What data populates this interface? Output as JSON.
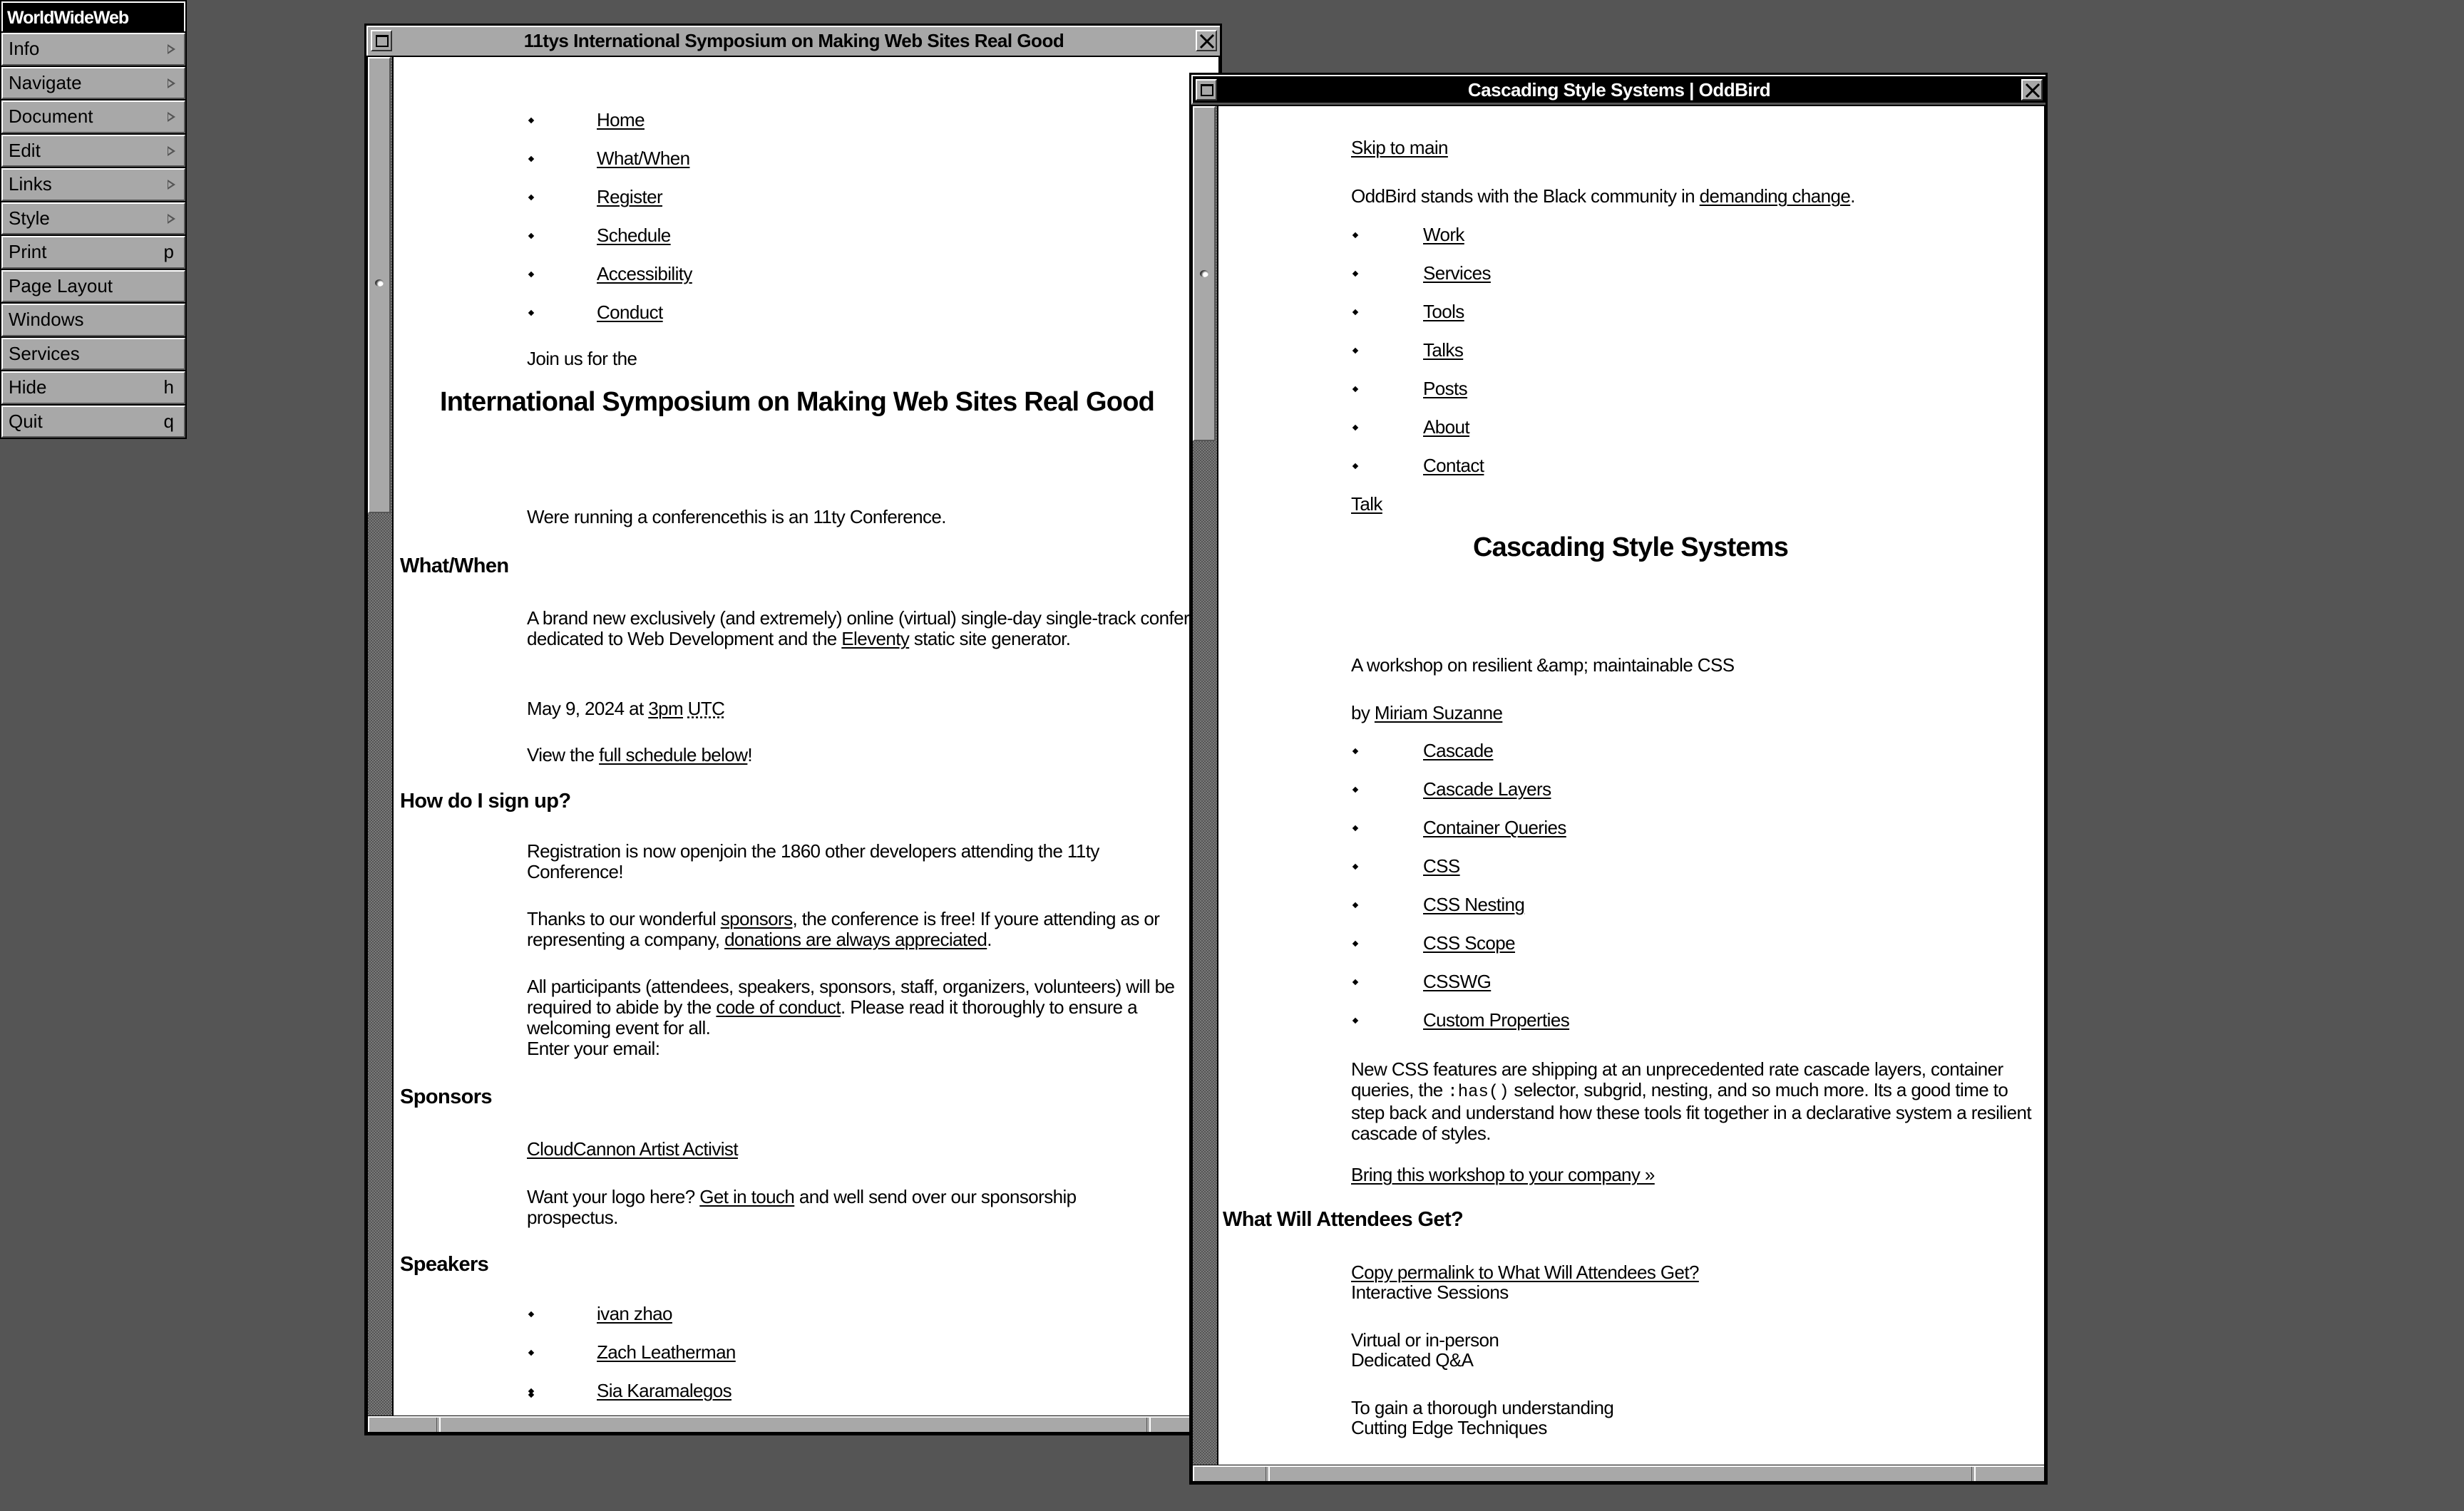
{
  "menu": {
    "title": "WorldWideWeb",
    "items": [
      {
        "label": "Info",
        "submenu": true
      },
      {
        "label": "Navigate",
        "submenu": true
      },
      {
        "label": "Document",
        "submenu": true
      },
      {
        "label": "Edit",
        "submenu": true
      },
      {
        "label": "Links",
        "submenu": true
      },
      {
        "label": "Style",
        "submenu": true
      },
      {
        "label": "Print",
        "key": "p"
      },
      {
        "label": "Page Layout"
      },
      {
        "label": "Windows"
      },
      {
        "label": "Services"
      },
      {
        "label": "Hide",
        "key": "h"
      },
      {
        "label": "Quit",
        "key": "q"
      }
    ]
  },
  "left_window": {
    "title": "11tys International Symposium on Making Web Sites Real Good",
    "nav": [
      "Home",
      "What/When",
      "Register",
      "Schedule",
      "Accessibility",
      "Conduct"
    ],
    "intro": "Join us for the",
    "heading": "International Symposium on Making Web Sites Real Good",
    "tagline": "Were running a conferencethis is an 11ty Conference.",
    "what_when": {
      "heading": "What/When",
      "desc_pre": "A brand new exclusively (and extremely) online (virtual) single-day single-track conference dedicated to Web Development and the ",
      "desc_link": "Eleventy",
      "desc_post": " static site generator.",
      "date_pre": "May 9, 2024 at ",
      "time_link": "3pm",
      "tz": "UTC",
      "view_pre": "View the ",
      "view_link": "full schedule below",
      "view_post": "!"
    },
    "signup": {
      "heading": "How do I sign up?",
      "registration": "Registration is now openjoin the 1860 other developers attending the 11ty Conference!",
      "thanks_pre": "Thanks to our wonderful ",
      "thanks_link": "sponsors",
      "thanks_mid": ", the conference is free! If youre attending as or representing a company, ",
      "donations_link": "donations are always appreciated",
      "thanks_post": ".",
      "conduct_pre": "All participants (attendees, speakers, sponsors, staff, organizers, volunteers) will be required to abide by the ",
      "conduct_link": "code of conduct",
      "conduct_post": ". Please read it thoroughly to ensure a welcoming event for all.",
      "email_label": "Enter your email:"
    },
    "sponsors": {
      "heading": "Sponsors",
      "list_link": "CloudCannon Artist Activist",
      "logo_pre": "Want your logo here? ",
      "logo_link": "Get in touch",
      "logo_post": " and well send over our sponsorship prospectus."
    },
    "speakers": {
      "heading": "Speakers",
      "list": [
        "ivan zhao",
        "Zach Leatherman",
        "Sia Karamalegos"
      ]
    }
  },
  "right_window": {
    "title": "Cascading Style Systems | OddBird",
    "skip_link": "Skip to main",
    "statement_pre": "OddBird stands with the Black community in ",
    "statement_link": "demanding change",
    "statement_post": ".",
    "nav": [
      "Work",
      "Services",
      "Tools",
      "Talks",
      "Posts",
      "About",
      "Contact"
    ],
    "breadcrumb_link": "Talk",
    "heading": "Cascading Style Systems",
    "subtitle": "A workshop on resilient &amp; maintainable CSS",
    "byline_pre": "by ",
    "author_link": "Miriam Suzanne",
    "tags": [
      "Cascade",
      "Cascade Layers",
      "Container Queries",
      "CSS",
      "CSS Nesting",
      "CSS Scope",
      "CSSWG",
      "Custom Properties"
    ],
    "description_pre": "New CSS features are shipping at an unprecedented rate cascade layers, container queries, the ",
    "description_code": ":has()",
    "description_post": " selector, subgrid, nesting, and so much more. Its a good time to step back and understand how these tools fit together in a declarative system a resilient cascade of styles.",
    "cta_link": "Bring this workshop to your company »",
    "attendees": {
      "heading": "What Will Attendees Get?",
      "permalink": "Copy permalink to What Will Attendees Get?",
      "lines": [
        "Interactive Sessions",
        "Virtual or in-person",
        "Dedicated Q&A",
        "To gain a thorough understanding",
        "Cutting Edge Techniques"
      ]
    }
  }
}
